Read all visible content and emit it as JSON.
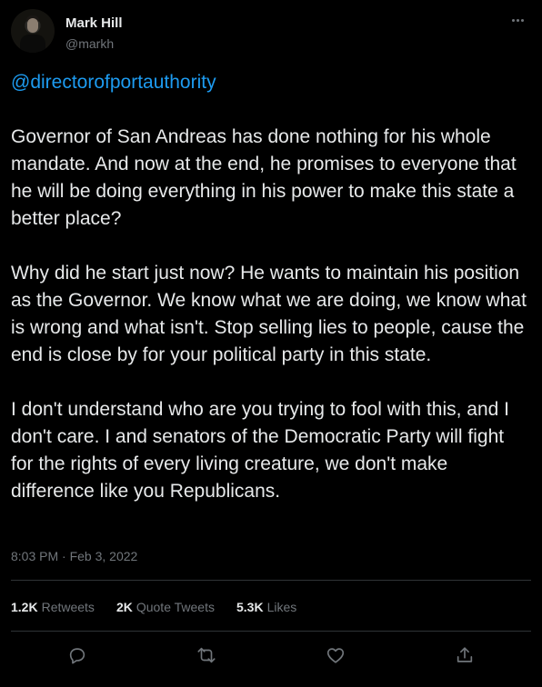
{
  "author": {
    "name": "Mark Hill",
    "handle": "@markh"
  },
  "tweet": {
    "mention": "@directorofportauthority",
    "paragraphs": [
      "Governor of San Andreas has done nothing for his whole mandate. And now at the end, he promises to everyone that he will be doing everything in his power to make this state a better place?",
      "Why did he start just now? He wants to maintain his position as the Governor. We know what we are doing, we know what is wrong and what isn't. Stop selling lies to people, cause the end is close by for your political party in this state.",
      "I don't understand who are you trying to fool with this, and I don't care. I and senators of the Democratic Party will fight for the rights of every living creature, we don't make difference like you Republicans."
    ],
    "timestamp": "8:03 PM · Feb 3, 2022"
  },
  "stats": {
    "retweets_count": "1.2K",
    "retweets_label": "Retweets",
    "quotes_count": "2K",
    "quotes_label": "Quote Tweets",
    "likes_count": "5.3K",
    "likes_label": "Likes"
  },
  "icons": {
    "more": "more-horizontal-icon",
    "reply": "reply-icon",
    "retweet": "retweet-icon",
    "like": "heart-icon",
    "share": "share-icon"
  },
  "colors": {
    "background": "#000000",
    "text": "#e7e9ea",
    "muted": "#71767b",
    "accent": "#1d9bf0",
    "divider": "#2f3336"
  }
}
